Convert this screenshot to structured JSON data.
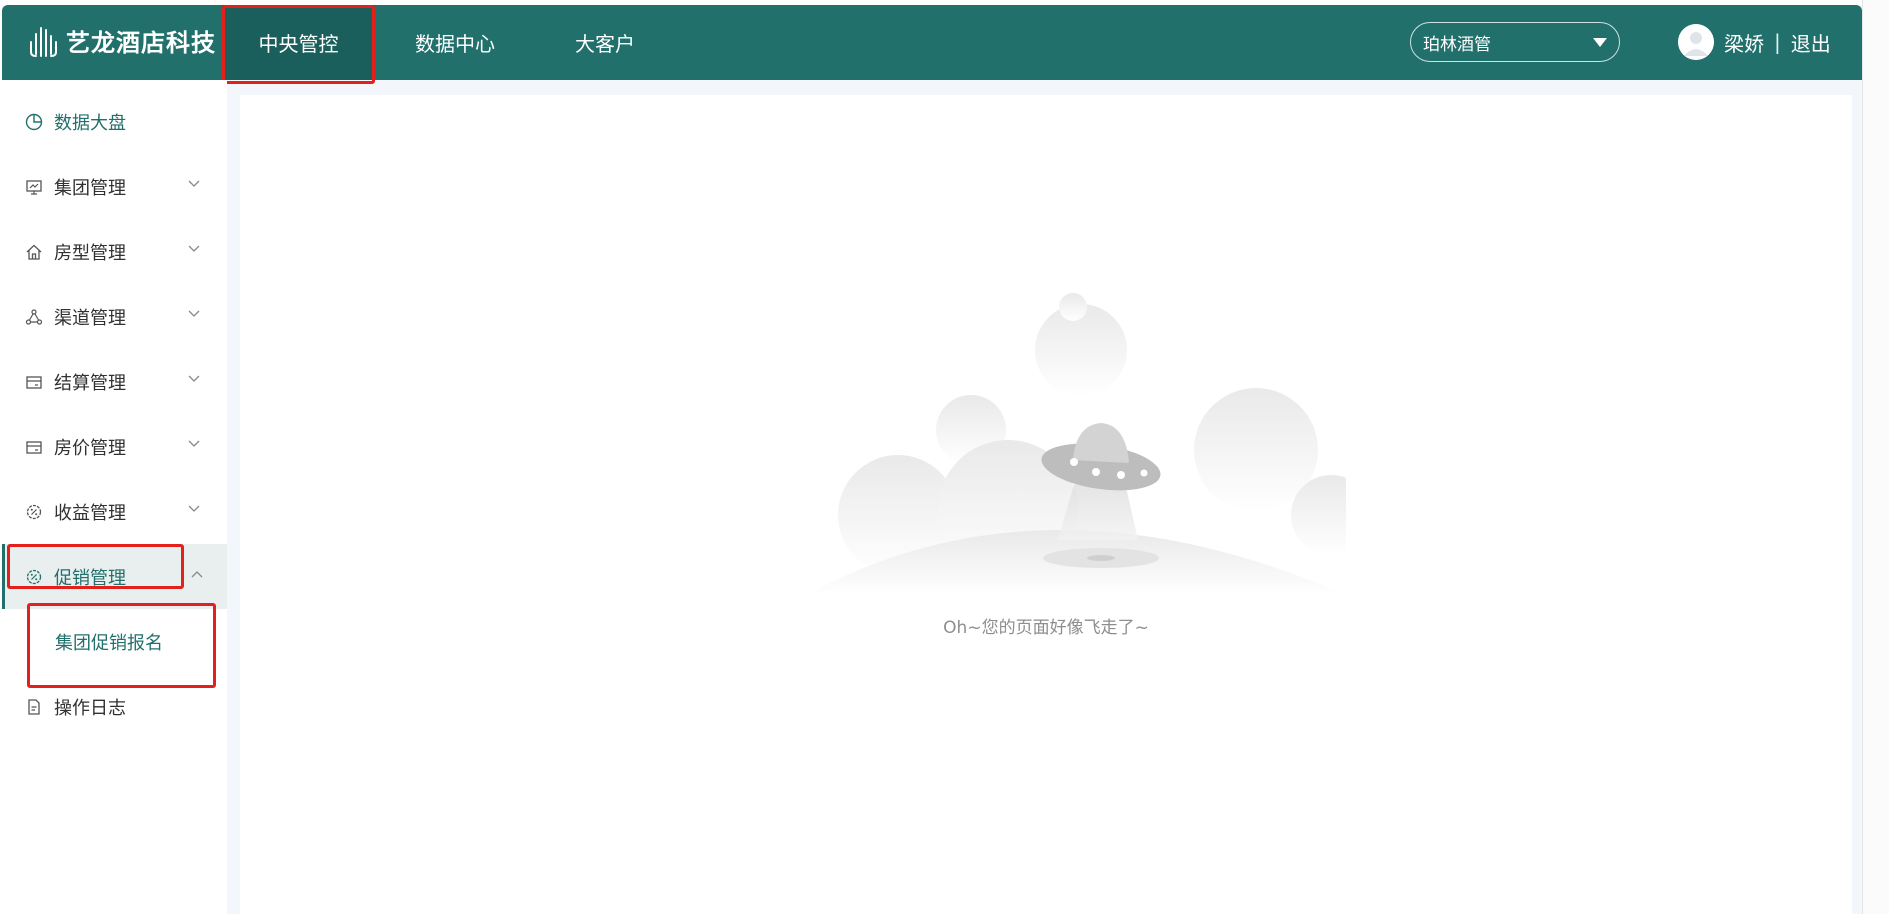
{
  "app": {
    "brand": "艺龙酒店科技",
    "nav": [
      {
        "label": "中央管控",
        "active": true
      },
      {
        "label": "数据中心",
        "active": false
      },
      {
        "label": "大客户",
        "active": false
      }
    ],
    "hotel_select": {
      "value": "珀林酒管"
    },
    "user": {
      "name": "梁娇",
      "divider": "|",
      "logout": "退出"
    }
  },
  "sidebar": {
    "items": [
      {
        "label": "数据大盘",
        "icon": "pie-chart-icon"
      },
      {
        "label": "集团管理",
        "icon": "monitor-icon"
      },
      {
        "label": "房型管理",
        "icon": "home-icon"
      },
      {
        "label": "渠道管理",
        "icon": "share-nodes-icon"
      },
      {
        "label": "结算管理",
        "icon": "card-icon"
      },
      {
        "label": "房价管理",
        "icon": "card-icon"
      },
      {
        "label": "收益管理",
        "icon": "gear-discount-icon"
      },
      {
        "label": "促销管理",
        "icon": "gear-discount-icon"
      },
      {
        "label": "操作日志",
        "icon": "document-icon"
      }
    ],
    "submenu": [
      {
        "label": "集团促销报名"
      }
    ]
  },
  "content": {
    "empty_message": "Oh~您的页面好像飞走了~"
  },
  "colors": {
    "brand": "#21706c",
    "highlight": "#e3201b"
  }
}
